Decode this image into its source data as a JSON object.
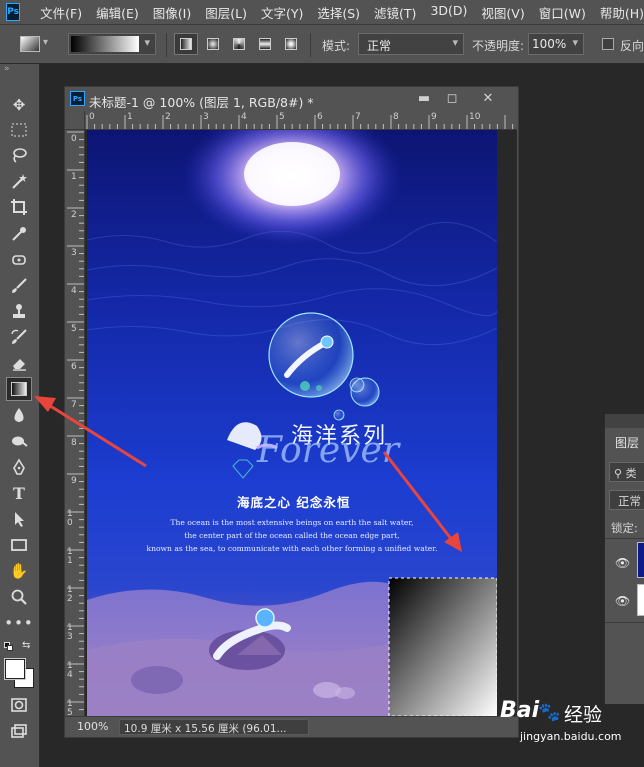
{
  "menu": [
    "文件(F)",
    "编辑(E)",
    "图像(I)",
    "图层(L)",
    "文字(Y)",
    "选择(S)",
    "滤镜(T)",
    "3D(D)",
    "视图(V)",
    "窗口(W)",
    "帮助(H)"
  ],
  "app_logo": "Ps",
  "options": {
    "mode_label": "模式:",
    "mode_value": "正常",
    "opacity_label": "不透明度:",
    "opacity_value": "100%",
    "reverse_label": "反向"
  },
  "document": {
    "title": "未标题-1 @ 100% (图层 1, RGB/8#) *",
    "zoom": "100%",
    "size_info": "10.9 厘米 x 15.56 厘米 (96.01..."
  },
  "ruler": {
    "h": [
      "0",
      "1",
      "2",
      "3",
      "4",
      "5",
      "6",
      "7",
      "8",
      "9",
      "10"
    ],
    "v": [
      "0",
      "1",
      "2",
      "3",
      "4",
      "5",
      "6",
      "7",
      "8",
      "9",
      "10",
      "11",
      "12",
      "13",
      "14",
      "15"
    ]
  },
  "poster": {
    "title_cn": "海洋系列",
    "title_en": "Forever",
    "subtitle": "海底之心  纪念永恒",
    "body": [
      "The ocean is the most extensive beings on earth the salt water,",
      "the center part of the ocean called the ocean edge part,",
      "known as the sea, to communicate with each other forming a unified water."
    ]
  },
  "layers": {
    "tab": "图层",
    "filter_label": "类",
    "blend": "正常",
    "lock_label": "锁定:"
  },
  "watermark": {
    "logo": "Bai",
    "brand": "经验",
    "url": "jingyan.baidu.com"
  },
  "colors": {
    "accent": "#e8453c",
    "panel": "#535353",
    "bg": "#282828",
    "poster_deep": "#0d1a8a"
  }
}
